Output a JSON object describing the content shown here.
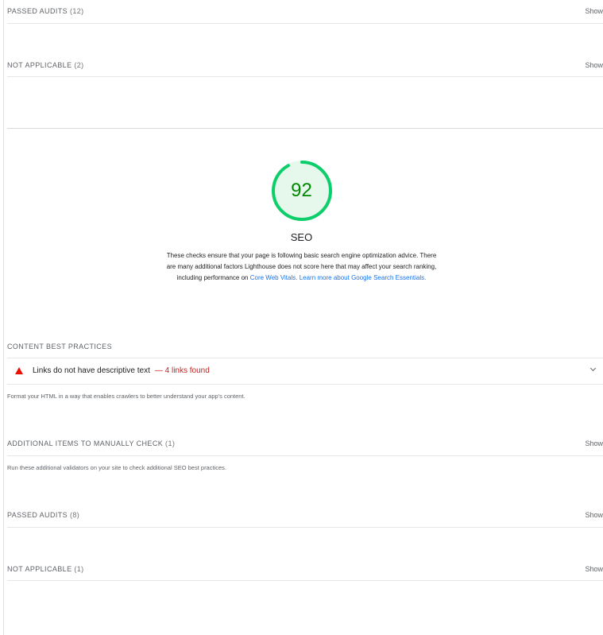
{
  "groups_top": [
    {
      "title": "PASSED AUDITS",
      "count": "(12)",
      "action": "Show"
    },
    {
      "title": "NOT APPLICABLE",
      "count": "(2)",
      "action": "Show"
    }
  ],
  "seo": {
    "score": "92",
    "score_fraction": 0.92,
    "score_color": "#0cce6b",
    "label": "SEO",
    "description": "These checks ensure that your page is following basic search engine optimization advice. There are many additional factors Lighthouse does not score here that may affect your search ranking, including performance on",
    "link_text": "Core Web Vitals. Learn more about Google Search Essentials."
  },
  "content_best_practices": {
    "title": "CONTENT BEST PRACTICES",
    "audit": {
      "title": "Links do not have descriptive text",
      "detail": "— 4 links found",
      "icon": "warning-triangle-icon",
      "color": "#eb0f00"
    },
    "note": "Format your HTML in a way that enables crawlers to better understand your app's content."
  },
  "manual": {
    "title": "ADDITIONAL ITEMS TO MANUALLY CHECK",
    "count": "(1)",
    "action": "Show",
    "note": "Run these additional validators on your site to check additional SEO best practices."
  },
  "groups_bottom": [
    {
      "title": "PASSED AUDITS",
      "count": "(8)",
      "action": "Show"
    },
    {
      "title": "NOT APPLICABLE",
      "count": "(1)",
      "action": "Show"
    }
  ]
}
